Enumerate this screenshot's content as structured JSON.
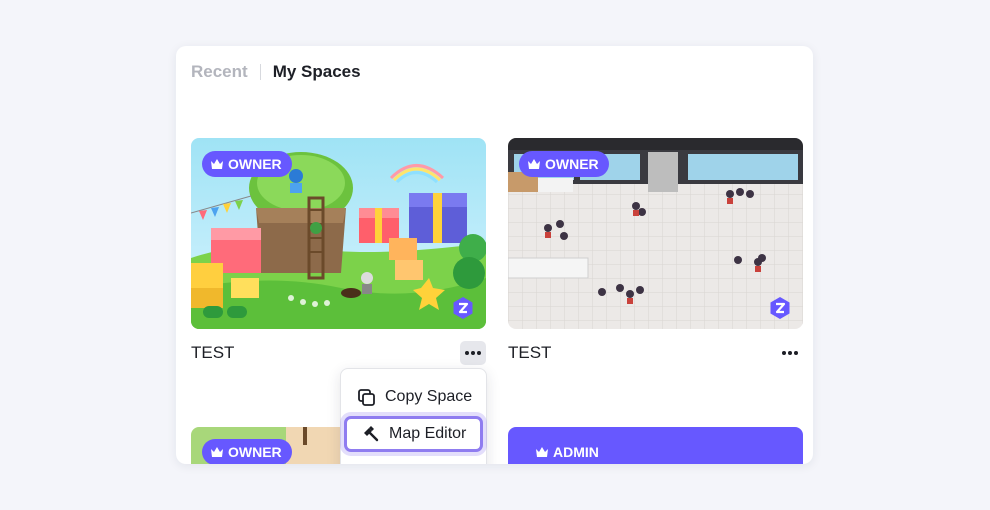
{
  "tabs": {
    "recent": "Recent",
    "my_spaces": "My Spaces"
  },
  "spaces": [
    {
      "title": "TEST",
      "role": "OWNER"
    },
    {
      "title": "TEST",
      "role": "OWNER"
    },
    {
      "role": "OWNER"
    },
    {
      "role": "ADMIN"
    }
  ],
  "context_menu": {
    "copy_space": "Copy Space",
    "map_editor": "Map Editor"
  },
  "colors": {
    "accent": "#6758ff",
    "highlight": "#8f7cf0"
  }
}
